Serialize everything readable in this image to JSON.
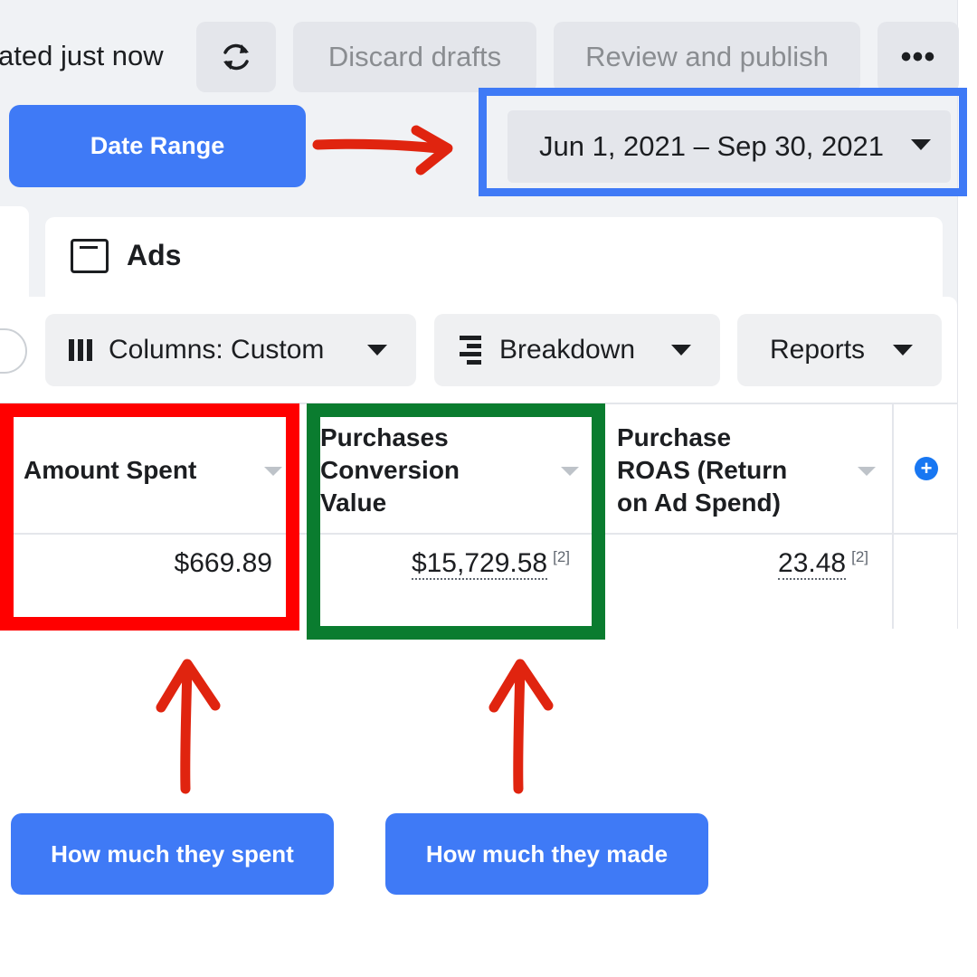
{
  "toolbar": {
    "status_text": "ated just now",
    "discard_label": "Discard drafts",
    "review_label": "Review and publish",
    "more_label": "•••"
  },
  "date_range": {
    "value": "Jun 1, 2021 – Sep 30, 2021"
  },
  "tab": {
    "ads_label": "Ads"
  },
  "table_toolbar": {
    "columns_label": "Columns: Custom",
    "breakdown_label": "Breakdown",
    "reports_label": "Reports"
  },
  "table": {
    "headers": [
      [
        "Amount Spent"
      ],
      [
        "Purchases",
        "Conversion",
        "Value"
      ],
      [
        "Purchase",
        "ROAS (Return",
        "on Ad Spend)"
      ]
    ],
    "row": {
      "amount_spent": "$669.89",
      "conversion_value": "$15,729.58",
      "conversion_value_footnote": "[2]",
      "roas": "23.48",
      "roas_footnote": "[2]"
    },
    "add_column_label": "+"
  },
  "annotations": {
    "date_range_callout": "Date Range",
    "spent_callout": "How much they spent",
    "made_callout": "How much they made",
    "colors": {
      "callout_blue": "#3f7af6",
      "arrow_red": "#e0240f",
      "spent_box_red": "#ff0000",
      "made_box_green": "#0a7c2f"
    }
  },
  "icons": [
    "refresh-icon",
    "more-icon",
    "caret-down-icon",
    "ads-icon",
    "columns-icon",
    "breakdown-icon",
    "sort-icon",
    "add-column-icon"
  ]
}
